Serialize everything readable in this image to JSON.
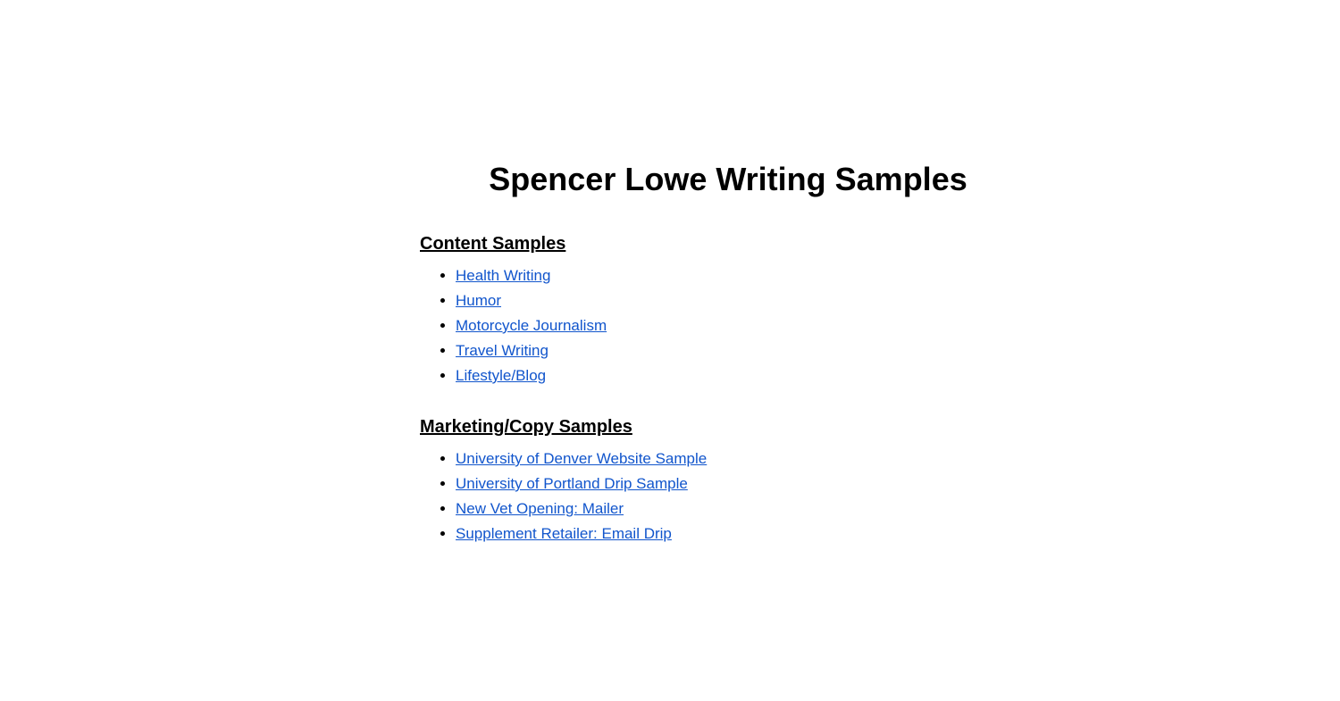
{
  "page": {
    "title": "Spencer Lowe Writing Samples"
  },
  "sections": [
    {
      "id": "content-samples",
      "heading": "Content Samples",
      "items": [
        {
          "label": "Health Writing",
          "href": "#"
        },
        {
          "label": "Humor",
          "href": "#"
        },
        {
          "label": "Motorcycle Journalism",
          "href": "#"
        },
        {
          "label": "Travel Writing",
          "href": "#"
        },
        {
          "label": "Lifestyle/Blog",
          "href": "#"
        }
      ]
    },
    {
      "id": "marketing-copy-samples",
      "heading": "Marketing/Copy Samples",
      "items": [
        {
          "label": "University of Denver Website Sample",
          "href": "#"
        },
        {
          "label": "University of Portland Drip Sample",
          "href": "#"
        },
        {
          "label": "New Vet Opening: Mailer",
          "href": "#"
        },
        {
          "label": "Supplement Retailer: Email Drip",
          "href": "#"
        }
      ]
    }
  ]
}
